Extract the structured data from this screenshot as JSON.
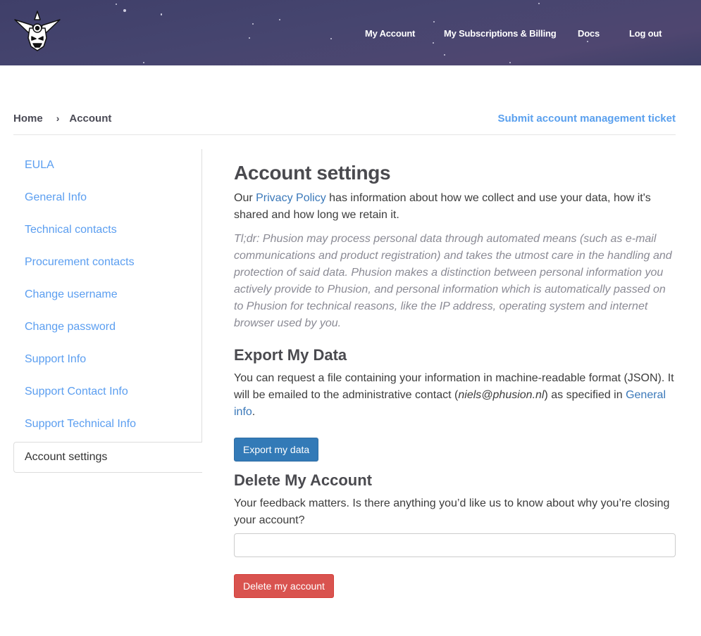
{
  "header": {
    "logo_alt": "Phusion robot logo",
    "nav": [
      {
        "label": "My Account"
      },
      {
        "label": "My Subscriptions & Billing"
      },
      {
        "label": "Docs"
      },
      {
        "label": "Log out"
      }
    ]
  },
  "breadcrumb": {
    "items": [
      "Home",
      "Account"
    ],
    "separator": "›"
  },
  "ticket_link": "Submit account management ticket",
  "sidebar": {
    "items": [
      {
        "label": "EULA"
      },
      {
        "label": "General Info"
      },
      {
        "label": "Technical contacts"
      },
      {
        "label": "Procurement contacts"
      },
      {
        "label": "Change username"
      },
      {
        "label": "Change password"
      },
      {
        "label": "Support Info"
      },
      {
        "label": "Support Contact Info"
      },
      {
        "label": "Support Technical Info"
      }
    ],
    "active": "Account settings"
  },
  "main": {
    "title": "Account settings",
    "intro": {
      "before": "Our ",
      "link": "Privacy Policy",
      "after": " has information about how we collect and use your data, how it's shared and how long we retain it."
    },
    "tldr": "Tl;dr: Phusion may process personal data through automated means (such as e-mail communications and product registration) and takes the utmost care in the handling and protection of said data. Phusion makes a distinction between personal information you actively provide to Phusion, and personal information which is automatically passed on to Phusion for technical reasons, like the IP address, operating system and internet browser used by you.",
    "export": {
      "heading": "Export My Data",
      "text_before": "You can request a file containing your information in machine-readable format (JSON). It will be emailed to the administrative contact (",
      "email": "niels@phusion.nl",
      "text_middle": ") as specified in ",
      "link": "General info",
      "text_after": ".",
      "button": "Export my data"
    },
    "delete": {
      "heading": "Delete My Account",
      "text": "Your feedback matters. Is there anything you’d like us to know about why you’re closing your account?",
      "input_value": "",
      "input_placeholder": "",
      "button": "Delete my account"
    }
  },
  "colors": {
    "link": "#5b9ef0",
    "primary": "#337ab7",
    "danger": "#d9534f",
    "header_bg": "#45446d"
  }
}
